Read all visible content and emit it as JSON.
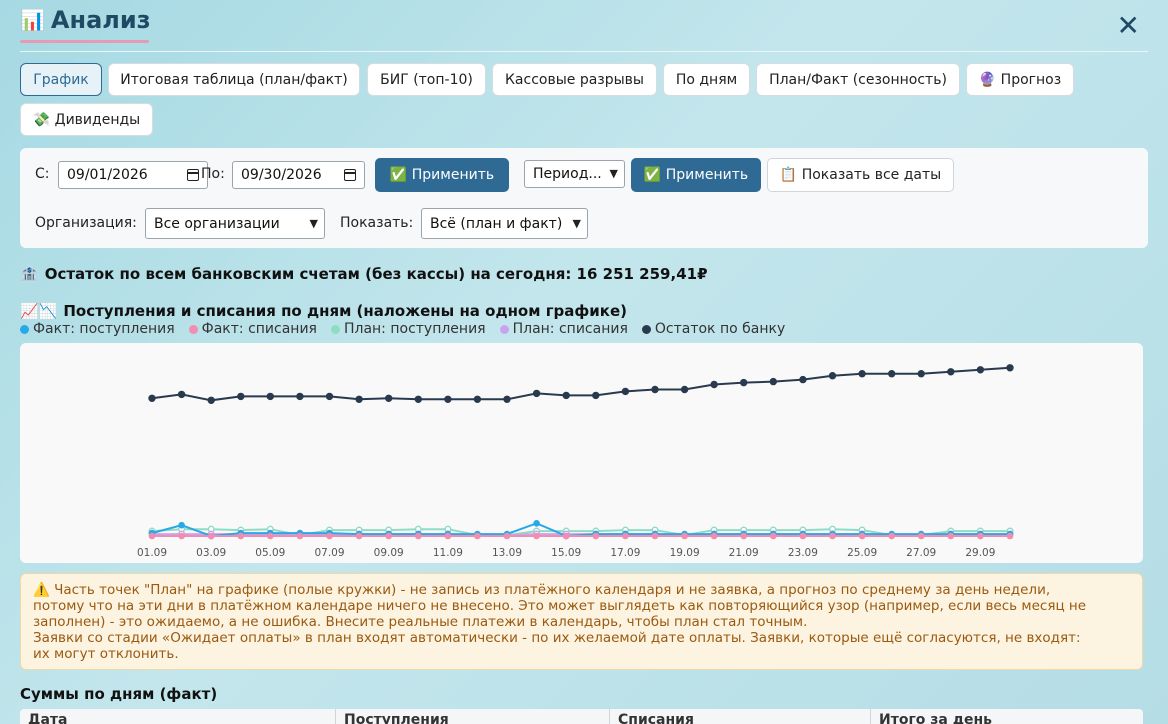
{
  "header": {
    "icon": "📊",
    "title": "Анализ",
    "close_label": "✕"
  },
  "tabs": [
    {
      "label": "График",
      "active": true
    },
    {
      "label": "Итоговая таблица (план/факт)"
    },
    {
      "label": "БИГ (топ-10)"
    },
    {
      "label": "Кассовые разрывы"
    },
    {
      "label": "По дням"
    },
    {
      "label": "План/Факт (сезонность)"
    },
    {
      "label": "🔮 Прогноз"
    },
    {
      "label": "💸 Дивиденды"
    }
  ],
  "filters": {
    "from_label": "С:",
    "from_value": "09/01/2026",
    "to_label": "По:",
    "to_value": "09/30/2026",
    "apply_label": "✅ Применить",
    "period_value": "Период...",
    "apply2_label": "✅ Применить",
    "show_all_label": "📋 Показать все даты",
    "org_label": "Организация:",
    "org_value": "Все организации",
    "show_label": "Показать:",
    "show_value": "Всё (план и факт)"
  },
  "balance": {
    "icon": "🏦",
    "text": "Остаток по всем банковским счетам (без кассы) на сегодня: 16 251 259,41₽"
  },
  "chart_title": {
    "icon": "📈📉",
    "text": "Поступления и списания по дням (наложены на одном графике)"
  },
  "colors": {
    "fact_in": "#2aa8e6",
    "fact_out": "#f08db0",
    "plan_in": "#8fdcc4",
    "plan_out": "#c9a3ef",
    "bank": "#2a3a4e"
  },
  "chart_data": {
    "type": "line",
    "x_ticks": [
      "01.09",
      "03.09",
      "05.09",
      "07.09",
      "09.09",
      "11.09",
      "13.09",
      "15.09",
      "17.09",
      "19.09",
      "21.09",
      "23.09",
      "25.09",
      "27.09",
      "29.09"
    ],
    "days": [
      "01.09",
      "02.09",
      "03.09",
      "04.09",
      "05.09",
      "06.09",
      "07.09",
      "08.09",
      "09.09",
      "10.09",
      "11.09",
      "12.09",
      "13.09",
      "14.09",
      "15.09",
      "16.09",
      "17.09",
      "18.09",
      "19.09",
      "20.09",
      "21.09",
      "22.09",
      "23.09",
      "24.09",
      "25.09",
      "26.09",
      "27.09",
      "28.09",
      "29.09",
      "30.09"
    ],
    "ylim": [
      0,
      18.5
    ],
    "series": [
      {
        "name": "Факт: поступления",
        "color": "#2aa8e6",
        "hollow": false,
        "values": [
          0.6,
          1.4,
          0.3,
          0.6,
          0.6,
          0.6,
          0.6,
          0.5,
          0.5,
          0.5,
          0.5,
          0.5,
          0.5,
          1.6,
          0.3,
          0.5,
          0.5,
          0.5,
          0.5,
          0.5,
          0.5,
          0.5,
          0.5,
          0.5,
          0.5,
          0.5,
          0.5,
          0.5,
          0.5,
          0.5
        ]
      },
      {
        "name": "Факт: списания",
        "color": "#f08db0",
        "hollow": false,
        "values": [
          0.3,
          0.3,
          0.3,
          0.3,
          0.3,
          0.3,
          0.3,
          0.3,
          0.3,
          0.3,
          0.3,
          0.3,
          0.3,
          0.3,
          0.3,
          0.3,
          0.3,
          0.3,
          0.3,
          0.3,
          0.3,
          0.3,
          0.3,
          0.3,
          0.3,
          0.3,
          0.3,
          0.3,
          0.3,
          0.3
        ]
      },
      {
        "name": "План: поступления",
        "color": "#8fdcc4",
        "hollow": true,
        "values": [
          0.8,
          1.0,
          1.0,
          0.9,
          1.0,
          0.4,
          0.9,
          0.9,
          0.9,
          1.0,
          1.0,
          0.4,
          0.4,
          0.8,
          0.8,
          0.8,
          0.9,
          0.9,
          0.4,
          0.9,
          0.9,
          0.9,
          0.9,
          1.0,
          0.9,
          0.4,
          0.4,
          0.8,
          0.8,
          0.8
        ]
      },
      {
        "name": "План: списания",
        "color": "#c9a3ef",
        "hollow": true,
        "values": [
          0.5,
          0.5,
          0.5,
          0.5,
          0.5,
          0.4,
          0.5,
          0.5,
          0.5,
          0.5,
          0.5,
          0.4,
          0.4,
          0.5,
          0.5,
          0.5,
          0.5,
          0.5,
          0.4,
          0.5,
          0.5,
          0.5,
          0.5,
          0.5,
          0.5,
          0.4,
          0.4,
          0.5,
          0.5,
          0.5
        ]
      },
      {
        "name": "Остаток по банку",
        "color": "#2a3a4e",
        "hollow": false,
        "values": [
          14.3,
          14.7,
          14.1,
          14.5,
          14.5,
          14.5,
          14.5,
          14.2,
          14.3,
          14.2,
          14.2,
          14.2,
          14.2,
          14.8,
          14.6,
          14.6,
          15.0,
          15.2,
          15.2,
          15.7,
          15.9,
          16.0,
          16.2,
          16.6,
          16.8,
          16.8,
          16.8,
          17.0,
          17.2,
          17.4
        ]
      }
    ]
  },
  "warning": {
    "line1": "⚠️ Часть точек \"План\" на графике (полые кружки) - не запись из платёжного календаря и не заявка, а прогноз по среднему за день недели,",
    "line2": "потому что на эти дни в платёжном календаре ничего не внесено. Это может выглядеть как повторяющийся узор (например, если весь месяц не",
    "line3": "заполнен) - это ожидаемо, а не ошибка. Внесите реальные платежи в календарь, чтобы план стал точным.",
    "line4": "Заявки со стадии «Ожидает оплаты» в план входят автоматически - по их желаемой дате оплаты. Заявки, которые ещё согласуются, не входят:",
    "line5": "их могут отклонить."
  },
  "summary": {
    "title": "Суммы по дням (факт)",
    "columns": [
      "Дата",
      "Поступления",
      "Списания",
      "Итого за день"
    ]
  }
}
